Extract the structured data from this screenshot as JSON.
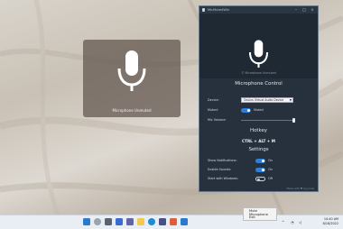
{
  "osd": {
    "label": "Microphone Unmuted",
    "icon": "microphone-icon"
  },
  "window": {
    "title": "MicMute4Win",
    "controls": [
      "minimize-icon",
      "maximize-icon",
      "close-icon"
    ],
    "subtitle": "© Microphone Unmuted"
  },
  "microphone_control": {
    "heading": "Microphone Control",
    "device_label": "Device:",
    "device_value": "Oculus Virtual Audio Device",
    "muted_label": "Muted:",
    "muted_state": "Muted",
    "volume_label": "Mic Volume:",
    "volume_value": 0.98
  },
  "hotkey": {
    "heading": "Hotkey",
    "combo": "CTRL + ALT + M"
  },
  "settings": {
    "heading": "Settings",
    "items": [
      {
        "label": "Show Notifications:",
        "state": "On"
      },
      {
        "label": "Enable Sounds:",
        "state": "On"
      },
      {
        "label": "Start with Windows:",
        "state": "Off"
      }
    ]
  },
  "footer": {
    "credit": "Made with ♥ by Jonas"
  },
  "context_menu": {
    "items": [
      "Mute Microphone",
      "Exit"
    ]
  },
  "taskbar": {
    "time": "10:40 AM",
    "date": "6/18/2022"
  },
  "colors": {
    "accent": "#2f7fd6",
    "window_bg": "#26313d",
    "header_bg": "#1e2934"
  }
}
